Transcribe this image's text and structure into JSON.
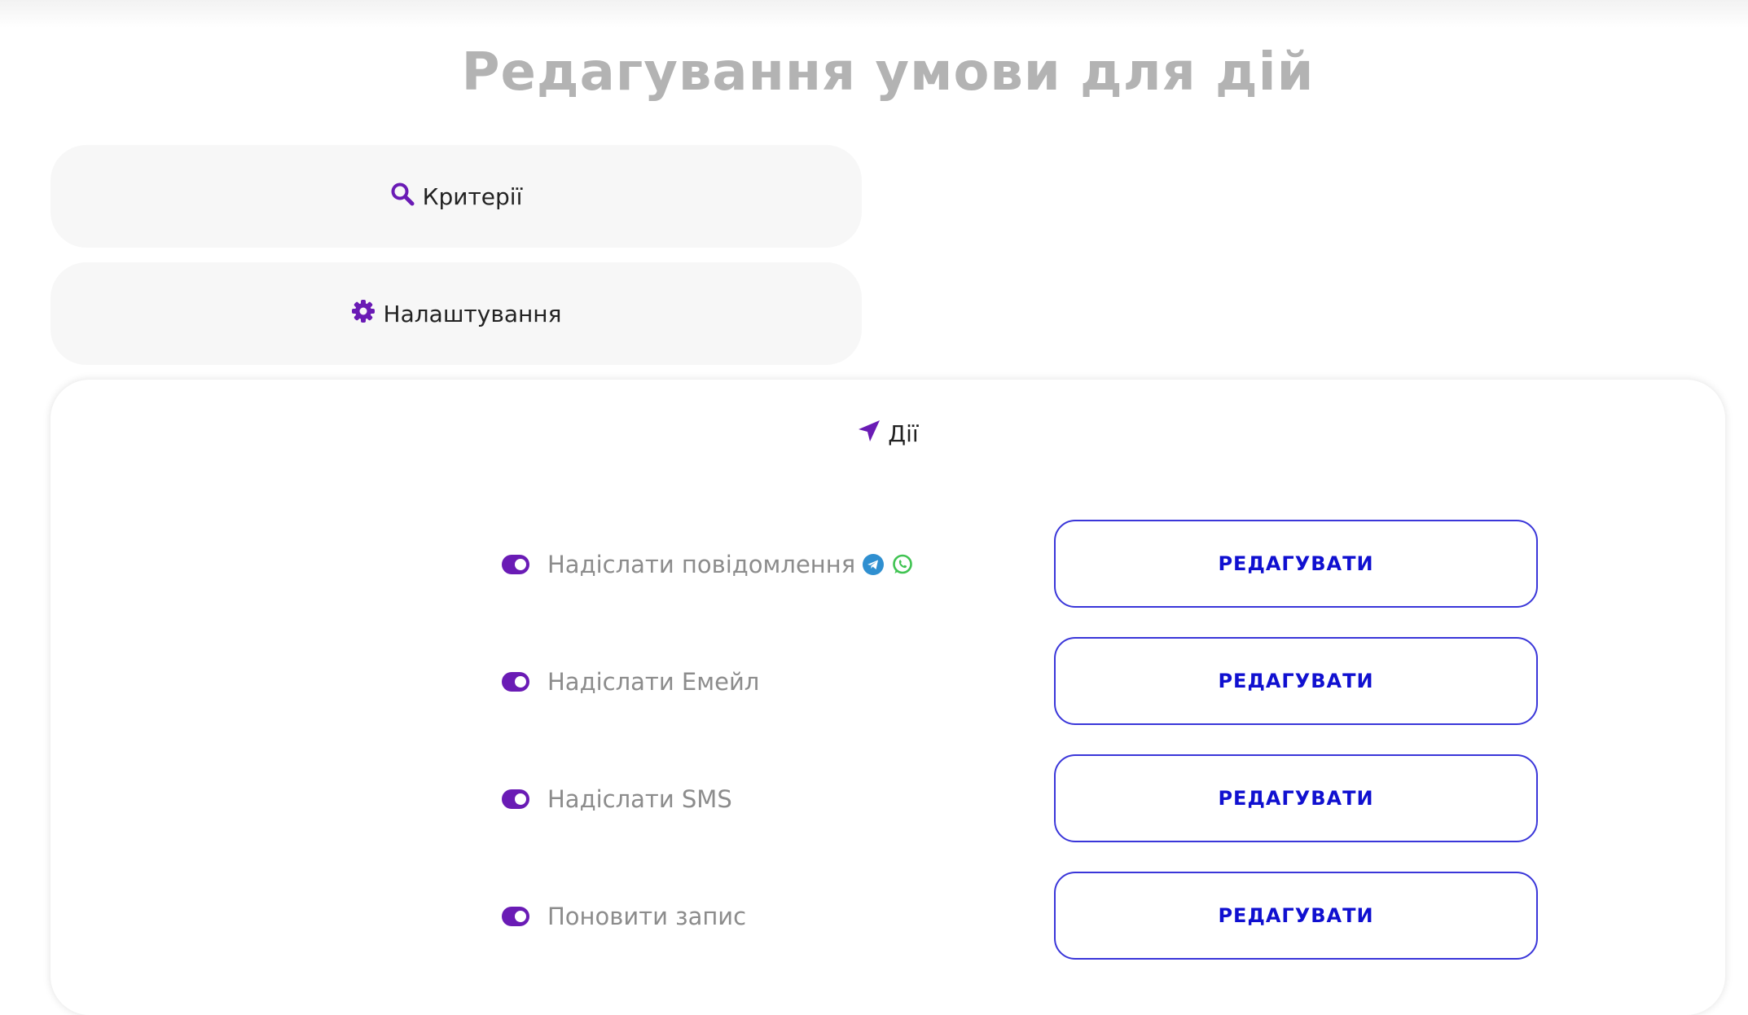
{
  "page": {
    "title": "Редагування умови для дій"
  },
  "accordions": {
    "criteria": {
      "label": "Критерії",
      "icon": "search-icon"
    },
    "settings": {
      "label": "Налаштування",
      "icon": "gear-icon"
    }
  },
  "actions_panel": {
    "header": {
      "label": "Дії",
      "icon": "paper-plane-icon"
    },
    "edit_label": "РЕДАГУВАТИ",
    "items": [
      {
        "label": "Надіслати повідомлення",
        "enabled": true,
        "icons": [
          "telegram-icon",
          "whatsapp-icon"
        ]
      },
      {
        "label": "Надіслати Емейл",
        "enabled": true
      },
      {
        "label": "Надіслати SMS",
        "enabled": true
      },
      {
        "label": "Поновити запис",
        "enabled": true
      }
    ]
  },
  "colors": {
    "accent": "#6a1bb5",
    "button_border": "#3a36d9",
    "button_text": "#1010d0",
    "title": "#b3b3b3",
    "telegram": "#2f8fd0",
    "whatsapp": "#3fc351"
  }
}
